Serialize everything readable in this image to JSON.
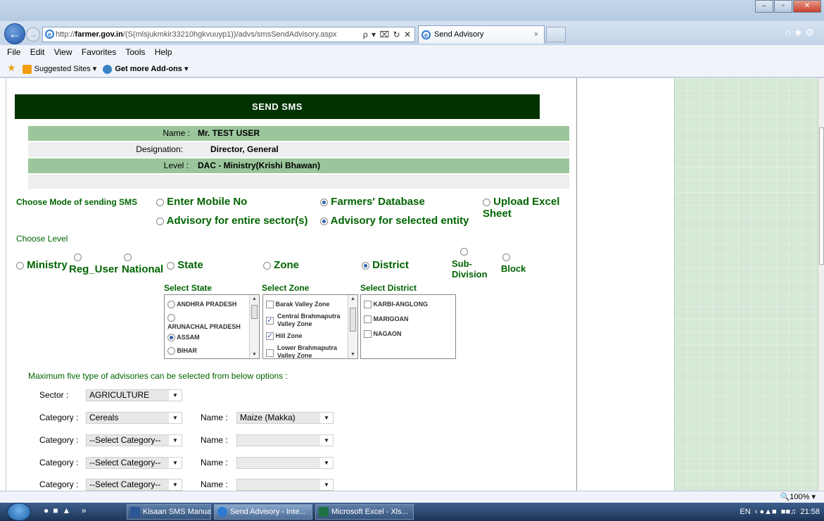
{
  "browser": {
    "address_prefix": "http://",
    "address_host": "farmer.gov.in",
    "address_rest": "/(S(mlsjukmkir33210hgkvuuyp1))/advs/smsSendAdvisory.aspx",
    "address_tools": "ρ ▾ ⌧ ↻ ✕",
    "tab_title": "Send Advisory",
    "tab_close": "×",
    "menu": [
      "File",
      "Edit",
      "View",
      "Favorites",
      "Tools",
      "Help"
    ],
    "fav_suggested": "Suggested Sites ▾",
    "fav_addons": "Get more Add-ons ▾",
    "zoom": "🔍100%  ▾",
    "window_buttons": [
      "–",
      "▫",
      "✕"
    ]
  },
  "page": {
    "header": "SEND SMS",
    "user": {
      "name_label": "Name :",
      "name_value": "Mr. TEST USER",
      "designation_label": "Designation:",
      "designation_value": "Director, General",
      "level_label": "Level :",
      "level_value": "DAC - Ministry(Krishi Bhawan)"
    },
    "mode_label": "Choose Mode of sending SMS",
    "mode_options": [
      "Enter Mobile No",
      "Farmers' Database",
      "Upload Excel Sheet"
    ],
    "scope_options": [
      "Advisory for entire sector(s)",
      "Advisory for selected entity"
    ],
    "choose_level_label": "Choose Level",
    "levels": [
      "Ministry",
      "Reg_User",
      "National",
      "State",
      "Zone",
      "District",
      "Sub-",
      "Division",
      "Block"
    ],
    "select_state_label": "Select State",
    "select_zone_label": "Select Zone",
    "select_district_label": "Select District",
    "states": [
      "ANDHRA PRADESH",
      "ARUNACHAL PRADESH",
      "ASSAM",
      "BIHAR"
    ],
    "zones": [
      "Barak Valley Zone",
      "Central Brahmaputra",
      "Valley Zone",
      "Hill Zone",
      "Lower Brahmaputra",
      "Valley Zone"
    ],
    "districts": [
      "KARBI-ANGLONG",
      "MARIGOAN",
      "NAGAON"
    ],
    "advisory_note": "Maximum five type of advisories can be selected from below options :",
    "sector_label": "Sector :",
    "sector_value": "AGRICULTURE",
    "category_label": "Category :",
    "name_label": "Name :",
    "rows": [
      {
        "category": "Cereals",
        "name": "Maize (Makka)"
      },
      {
        "category": "--Select Category--",
        "name": ""
      },
      {
        "category": "--Select Category--",
        "name": ""
      },
      {
        "category": "--Select Category--",
        "name": ""
      }
    ]
  },
  "taskbar": {
    "tasks": [
      "Kisaan SMS Manual....",
      "Send Advisory - Inte...",
      "Microsoft Excel - Xls..."
    ],
    "tray_lang": "EN",
    "clock": "21:58"
  }
}
